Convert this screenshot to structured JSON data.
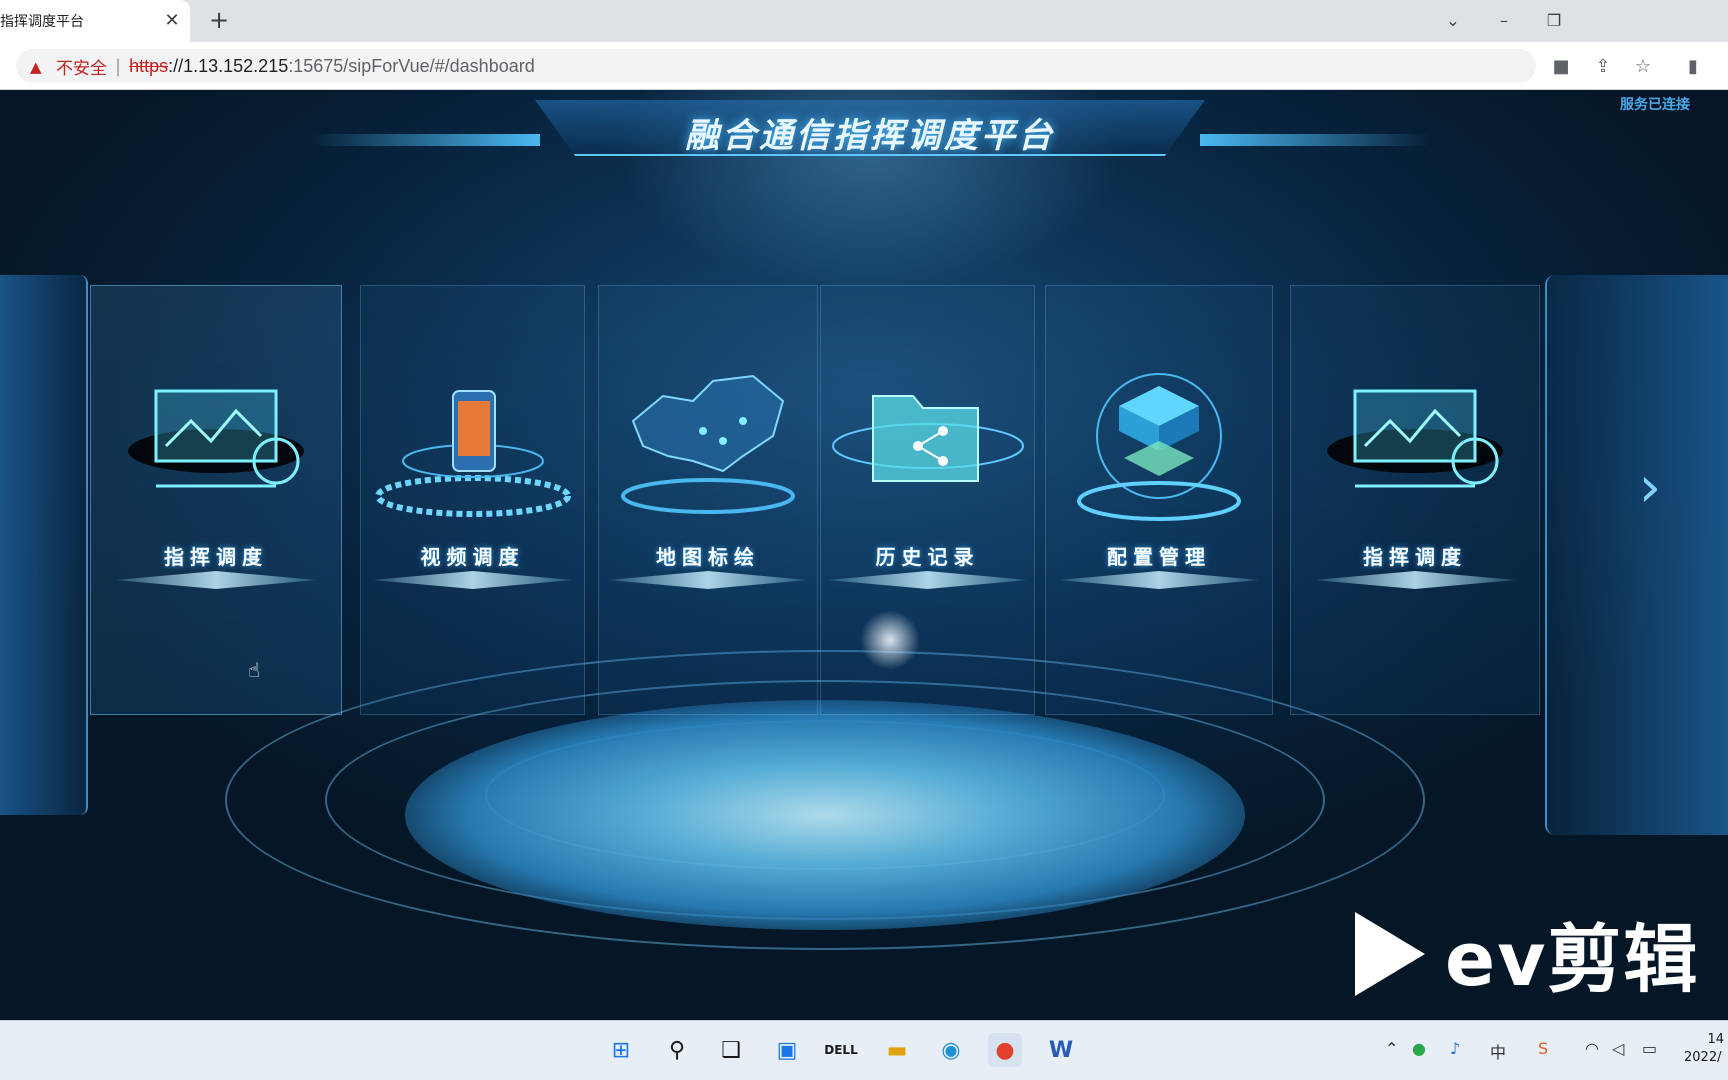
{
  "browser": {
    "tab_title": "指挥调度平台",
    "tab_close": "✕",
    "new_tab": "+",
    "security_label": "不安全",
    "url_scheme": "https",
    "url_host": "://1.13.152.215",
    "url_rest": ":15675/sipForVue/#/dashboard"
  },
  "page": {
    "title": "融合通信指挥调度平台",
    "connection_status": "服务已连接",
    "cards": [
      {
        "label": "指挥调度",
        "icon": "monitor-chart-icon"
      },
      {
        "label": "视频调度",
        "icon": "phone-video-icon"
      },
      {
        "label": "地图标绘",
        "icon": "china-map-icon"
      },
      {
        "label": "历史记录",
        "icon": "folder-icon"
      },
      {
        "label": "配置管理",
        "icon": "server-stack-icon"
      },
      {
        "label": "指挥调度",
        "icon": "monitor-chart-icon"
      }
    ],
    "next_arrow": "›"
  },
  "watermark": {
    "text": "ev剪辑"
  },
  "taskbar": {
    "clock_time": "14",
    "clock_date": "2022/"
  },
  "colors": {
    "accent": "#3fb6ff",
    "page_bg": "#07223c",
    "insecure_red": "#c5221f"
  }
}
